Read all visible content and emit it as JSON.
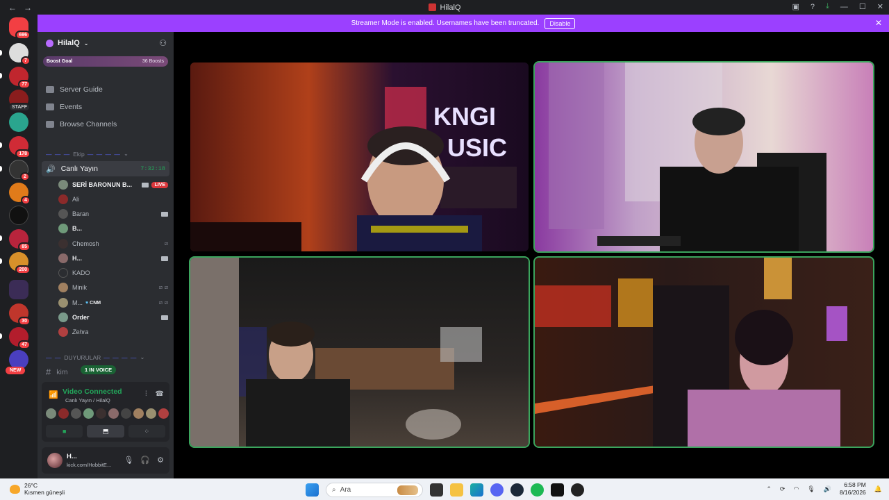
{
  "window": {
    "title": "HilalQ",
    "nav_back": "←",
    "nav_forward": "→"
  },
  "banner": {
    "message": "Streamer Mode is enabled. Usernames have been truncated.",
    "disable_label": "Disable",
    "close_glyph": "✕"
  },
  "guilds": {
    "home_badge": "696",
    "badges": [
      "7",
      "77",
      "STAFF",
      "178",
      "2",
      "4",
      "85",
      "200",
      "30",
      "47"
    ],
    "new_label": "NEW"
  },
  "server": {
    "name": "HilalQ",
    "boost_goal": "Boost Goal",
    "boost_count": "36 Boosts",
    "menu": [
      "Server Guide",
      "Events",
      "Browse Channels"
    ]
  },
  "categories": {
    "ekip": "Ekip",
    "duyurular": "DUYURULAR"
  },
  "voice_channel": {
    "name": "Canlı Yayın",
    "timer": "7:32:18",
    "members": [
      {
        "name": "SERİ BARONUN B...",
        "live": "LIVE"
      },
      {
        "name": "Ali"
      },
      {
        "name": "Baran"
      },
      {
        "name": "B..."
      },
      {
        "name": "Chemosh"
      },
      {
        "name": "H..."
      },
      {
        "name": "KADO"
      },
      {
        "name": "Minik"
      },
      {
        "name": "M...",
        "role": "CNM"
      },
      {
        "name": "Order"
      },
      {
        "name": "Zehra"
      }
    ]
  },
  "text_channel": {
    "name": "kim",
    "in_voice": "1 IN VOICE"
  },
  "voice_panel": {
    "status": "Video Connected",
    "location": "Canlı Yayın / HilalQ"
  },
  "user": {
    "name": "H...",
    "status": "kick.com/HobbitE..."
  },
  "taskbar": {
    "temperature": "26°C",
    "weather": "Kısmen güneşli",
    "search_placeholder": "Ara",
    "time": "6:58 PM",
    "date": "8/16/2026"
  },
  "colors": {
    "accent": "#9b40ff",
    "speaking": "#3ba55d",
    "live": "#da373c",
    "sidebar": "#2b2d31"
  }
}
